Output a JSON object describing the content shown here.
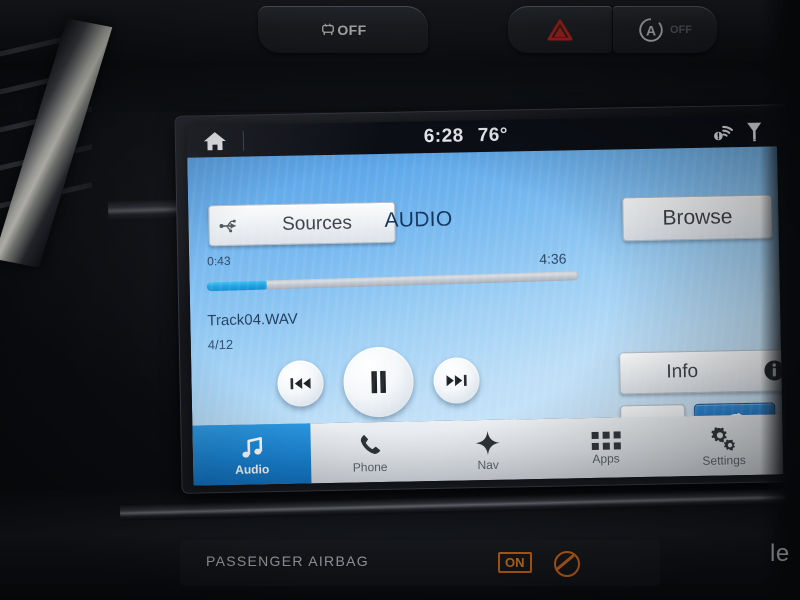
{
  "vehicle": {
    "physical_buttons": [
      {
        "name": "traction-control-off",
        "label": "OFF",
        "icon": "car-skid-icon"
      },
      {
        "name": "hazard-lights",
        "label": "",
        "icon": "hazard-triangle-icon"
      },
      {
        "name": "auto-start-stop",
        "label": "OFF",
        "icon": "auto-start-stop-icon"
      }
    ],
    "airbag_plate": {
      "label": "PASSENGER AIRBAG",
      "status": "ON"
    },
    "edge_text": "le"
  },
  "screen": {
    "statusbar": {
      "home_icon": "home-icon",
      "time": "6:28",
      "temperature": "76°",
      "wifi_icon": "wifi-warning-icon",
      "signal_icon": "signal-icon"
    },
    "header": {
      "sources_label": "Sources",
      "sources_icon": "usb-icon",
      "mode_label": "AUDIO",
      "browse_label": "Browse"
    },
    "player": {
      "elapsed": "0:43",
      "duration": "4:36",
      "progress_percent": 16,
      "track_title": "Track04.WAV",
      "track_index": "4/12",
      "prev_icon": "previous-track-icon",
      "play_pause_icon": "pause-icon",
      "next_icon": "next-track-icon",
      "info_label": "Info",
      "info_icon": "info-circle-icon",
      "shuffle_icon": "shuffle-icon",
      "shuffle_active": false,
      "repeat_icon": "repeat-icon",
      "repeat_active": true
    },
    "navbar": [
      {
        "label": "Audio",
        "icon": "music-note-icon",
        "active": true
      },
      {
        "label": "Phone",
        "icon": "phone-handset-icon",
        "active": false
      },
      {
        "label": "Nav",
        "icon": "nav-star-icon",
        "active": false
      },
      {
        "label": "Apps",
        "icon": "apps-grid-icon",
        "active": false
      },
      {
        "label": "Settings",
        "icon": "gears-icon",
        "active": false
      }
    ]
  },
  "colors": {
    "accent_blue": "#1b84d3",
    "progress_fill": "#17a0e2",
    "repeat_active_bg": "#1a6fc4",
    "screen_bg_top": "#4f9de6",
    "screen_bg_bottom": "#d2e8f9",
    "statusbar_bg": "#0c0f16",
    "navbar_bg": "#e2e6ea",
    "hazard_red": "#c32a22",
    "airbag_orange": "#e8741a"
  }
}
